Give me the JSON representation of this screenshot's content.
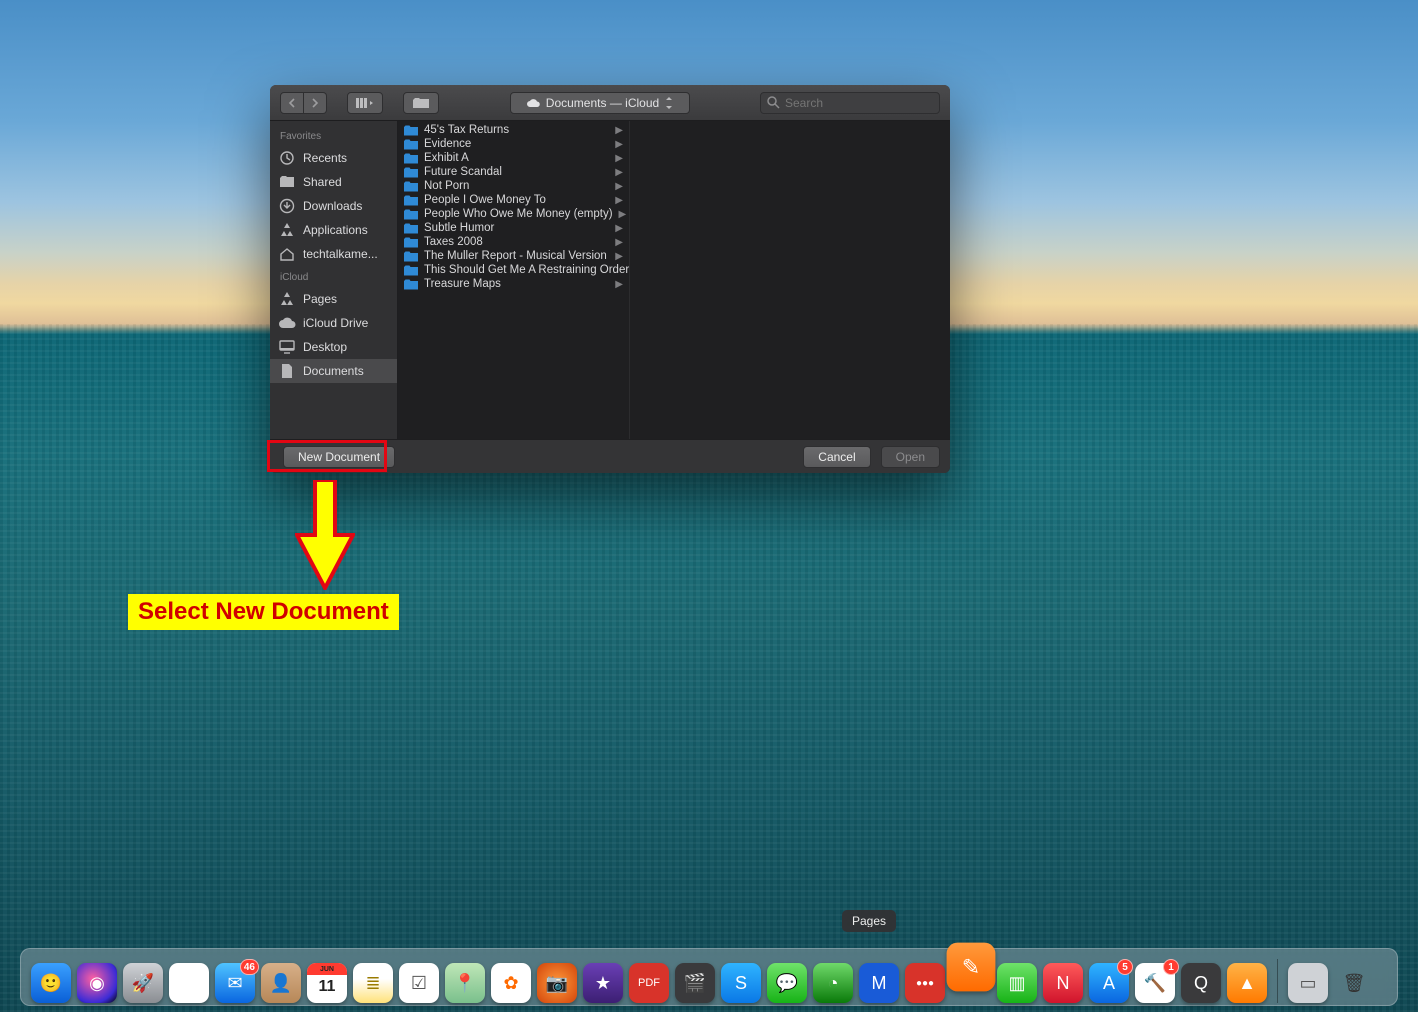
{
  "toolbar": {
    "location_label": "Documents — iCloud",
    "search_placeholder": "Search"
  },
  "sidebar": {
    "sections": [
      {
        "title": "Favorites",
        "items": [
          {
            "label": "Recents",
            "icon": "clock"
          },
          {
            "label": "Shared",
            "icon": "folder"
          },
          {
            "label": "Downloads",
            "icon": "download"
          },
          {
            "label": "Applications",
            "icon": "apps"
          },
          {
            "label": "techtalkame...",
            "icon": "home"
          }
        ]
      },
      {
        "title": "iCloud",
        "items": [
          {
            "label": "Pages",
            "icon": "pages"
          },
          {
            "label": "iCloud Drive",
            "icon": "cloud"
          },
          {
            "label": "Desktop",
            "icon": "desktop"
          },
          {
            "label": "Documents",
            "icon": "doc",
            "active": true
          }
        ]
      }
    ]
  },
  "files": [
    "45's Tax Returns",
    "Evidence",
    "Exhibit A",
    "Future Scandal",
    "Not Porn",
    "People I Owe Money To",
    "People Who Owe Me Money (empty)",
    "Subtle Humor",
    "Taxes 2008",
    "The Muller Report - Musical Version",
    "This Should Get Me A Restraining Order",
    "Treasure Maps"
  ],
  "footer": {
    "new_document": "New Document",
    "cancel": "Cancel",
    "open": "Open"
  },
  "annotation": {
    "label": "Select New Document"
  },
  "dock": {
    "tooltip": "Pages",
    "items": [
      {
        "name": "finder",
        "bg": "linear-gradient(#3aa0ff,#0a5fd6)",
        "glyph": "🙂"
      },
      {
        "name": "siri",
        "bg": "radial-gradient(circle at 40% 40%,#ff5fa2,#3b2bd6 70%,#000)",
        "glyph": "◉"
      },
      {
        "name": "launchpad",
        "bg": "linear-gradient(#cfd2d6,#8a8d92)",
        "glyph": "🚀"
      },
      {
        "name": "chrome",
        "bg": "#fff",
        "glyph": "◎"
      },
      {
        "name": "mail",
        "bg": "linear-gradient(#4fc3ff,#0a66e0)",
        "glyph": "✉",
        "badge": "46"
      },
      {
        "name": "contacts",
        "bg": "linear-gradient(#d7b089,#b78858)",
        "glyph": "👤"
      },
      {
        "name": "calendar",
        "bg": "#fff",
        "glyph": "11",
        "text": "#222",
        "top": "JUN"
      },
      {
        "name": "notes",
        "bg": "linear-gradient(#fff 40%,#ffe27a)",
        "glyph": "≣",
        "text": "#9a7b00"
      },
      {
        "name": "reminders",
        "bg": "#fff",
        "glyph": "☑",
        "text": "#555"
      },
      {
        "name": "maps",
        "bg": "linear-gradient(#bfe6b7,#7ac08c)",
        "glyph": "📍"
      },
      {
        "name": "photos",
        "bg": "#fff",
        "glyph": "✿",
        "text": "#ff6a00"
      },
      {
        "name": "photobooth",
        "bg": "radial-gradient(circle,#ff9a3c,#d2440a)",
        "glyph": "📷"
      },
      {
        "name": "imovie",
        "bg": "linear-gradient(#6a3fb5,#3c1f73)",
        "glyph": "★"
      },
      {
        "name": "pdf",
        "bg": "#d8332a",
        "glyph": "PDF",
        "fs": "11"
      },
      {
        "name": "finalcut",
        "bg": "#3a3a3c",
        "glyph": "🎬"
      },
      {
        "name": "skype",
        "bg": "linear-gradient(#2fb4ff,#0a78e6)",
        "glyph": "S"
      },
      {
        "name": "messages",
        "bg": "linear-gradient(#6fe26a,#17b317)",
        "glyph": "💬"
      },
      {
        "name": "activity",
        "bg": "linear-gradient(#6fd96a,#0a7a0a)",
        "glyph": "◔"
      },
      {
        "name": "malwarebytes",
        "bg": "#195bd7",
        "glyph": "M"
      },
      {
        "name": "1password",
        "bg": "#d8332a",
        "glyph": "●●●",
        "fs": "10"
      },
      {
        "name": "pages",
        "bg": "linear-gradient(#ff9a3c,#ff6a00)",
        "glyph": "✎",
        "elevated": true
      },
      {
        "name": "numbers",
        "bg": "linear-gradient(#6fe26a,#17b317)",
        "glyph": "▥"
      },
      {
        "name": "news",
        "bg": "linear-gradient(#ff5a5a,#d0142c)",
        "glyph": "N"
      },
      {
        "name": "appstore",
        "bg": "linear-gradient(#2fb4ff,#0a66e0)",
        "glyph": "A",
        "badge": "5"
      },
      {
        "name": "xcode",
        "bg": "#fff",
        "glyph": "🔨",
        "badge": "1"
      },
      {
        "name": "quicktime",
        "bg": "#3a3a3c",
        "glyph": "Q"
      },
      {
        "name": "vlc",
        "bg": "linear-gradient(#ffb347,#ff7a00)",
        "glyph": "▲"
      }
    ],
    "right_items": [
      {
        "name": "downloads-stack",
        "bg": "#cfd2d6",
        "glyph": "▭",
        "text": "#555"
      },
      {
        "name": "trash",
        "bg": "transparent",
        "glyph": "🗑",
        "text": "#333",
        "shadow": "none"
      }
    ]
  }
}
